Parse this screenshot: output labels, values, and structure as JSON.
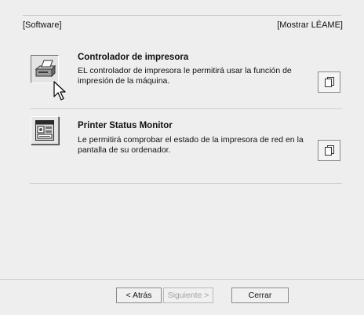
{
  "header": {
    "left_label": "[Software]",
    "right_label": "[Mostrar LÉAME]"
  },
  "items": [
    {
      "title": "Controlador de impresora",
      "description": "EL controlador de impresora le permitirá usar la función de impresión de la máquina.",
      "icon": "printer-icon",
      "doc_icon": "document-icon"
    },
    {
      "title": "Printer Status Monitor",
      "description": "Le permitirá comprobar el estado de la impresora de red en la pantalla de su ordenador.",
      "icon": "status-monitor-icon",
      "doc_icon": "document-icon"
    }
  ],
  "footer": {
    "back_label": "< Atrás",
    "next_label": "Siguiente >",
    "close_label": "Cerrar"
  }
}
